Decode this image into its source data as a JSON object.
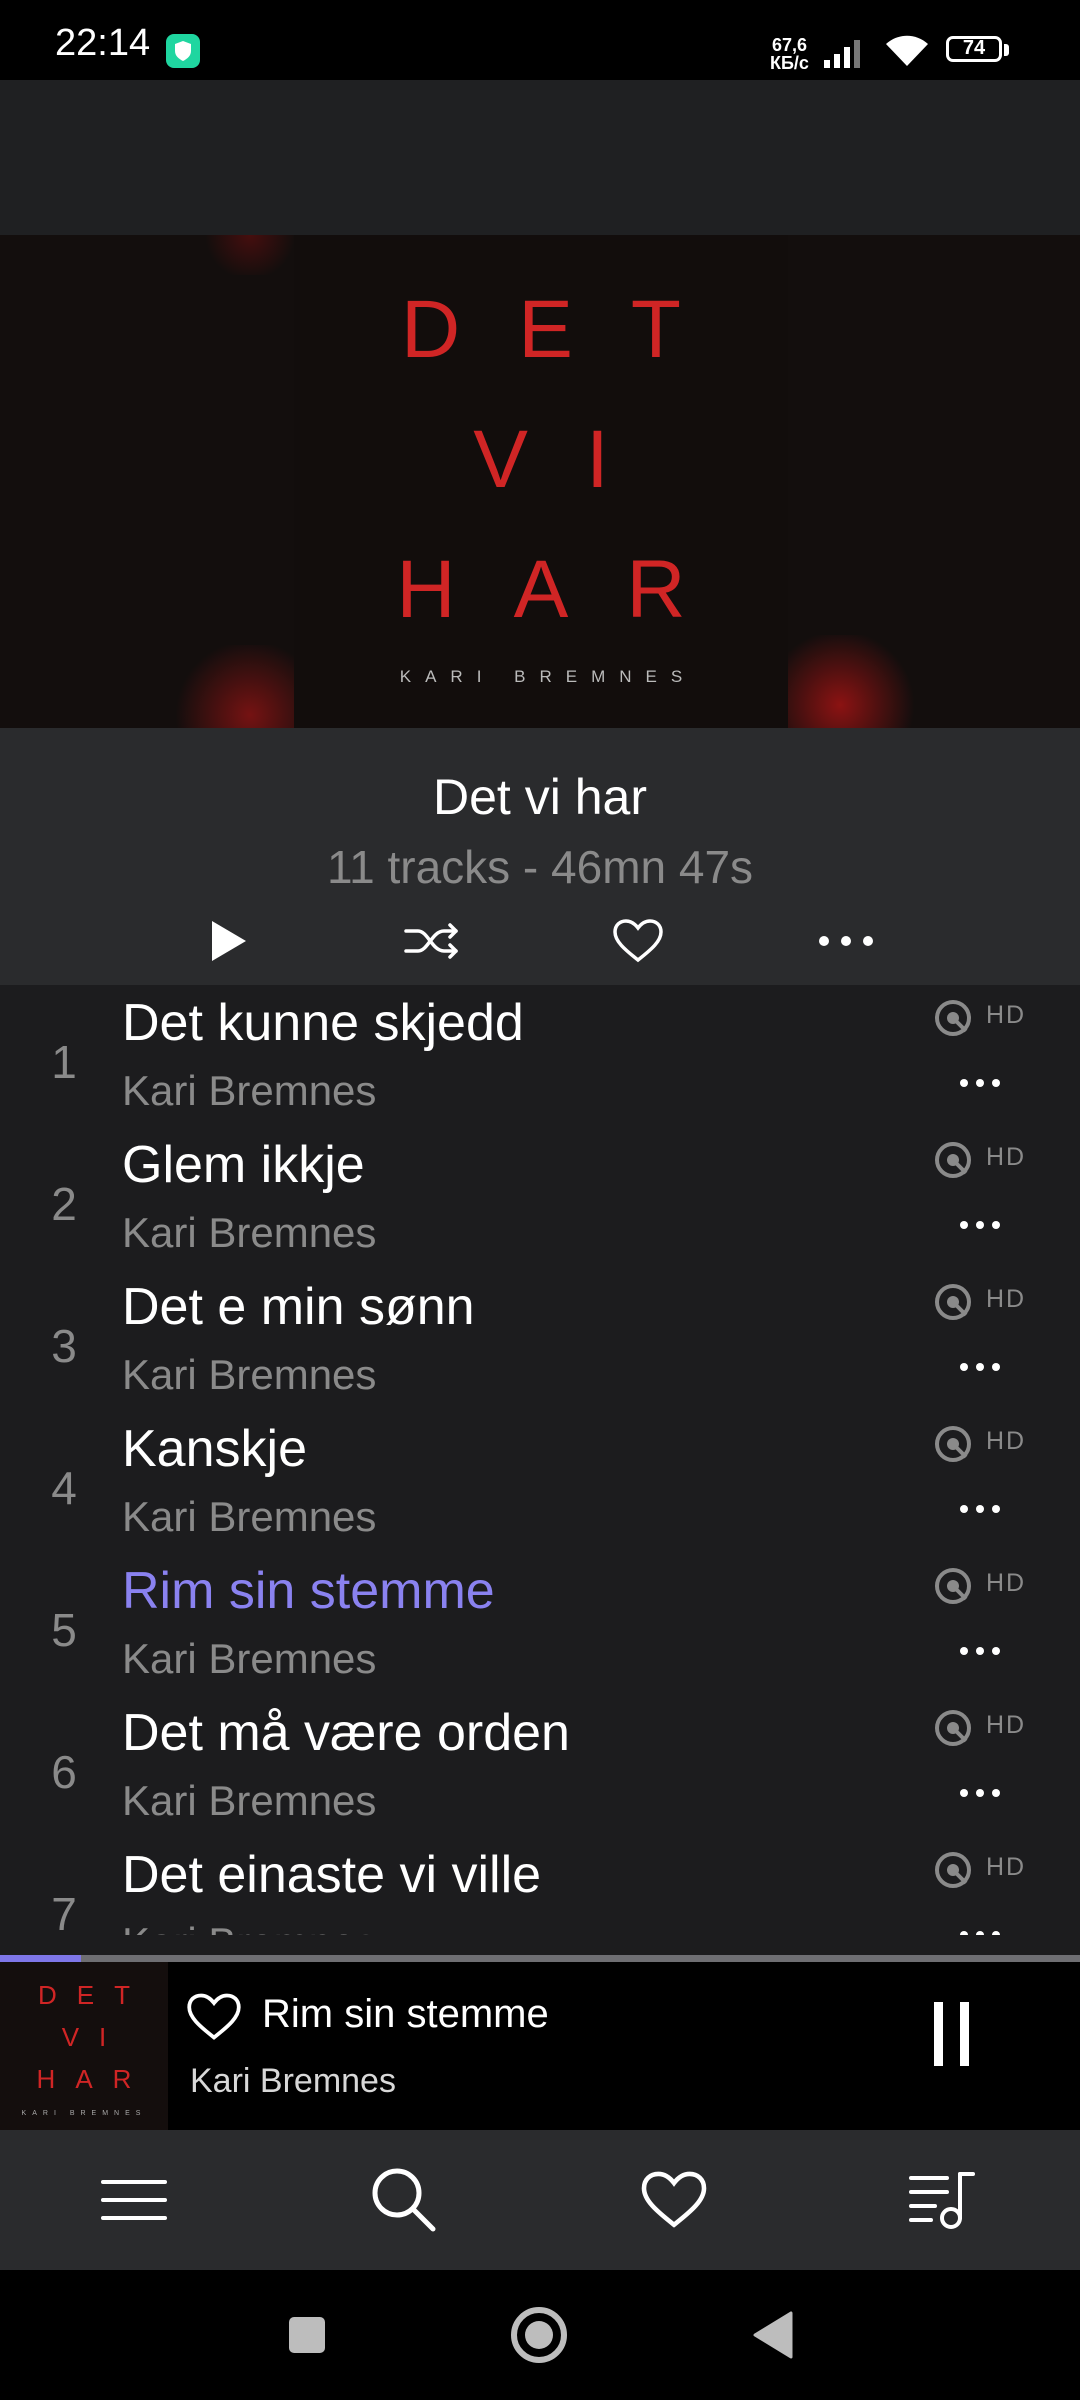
{
  "status_bar": {
    "time": "22:14",
    "net_speed_value": "67,6",
    "net_speed_unit": "КБ/с",
    "battery": "74"
  },
  "album_cover": {
    "line1": "DET",
    "line2": "VI",
    "line3": "HAR",
    "artist": "KARI BREMNES"
  },
  "album": {
    "title": "Det vi har",
    "meta": "11 tracks - 46mn 47s"
  },
  "tracks": [
    {
      "number": "1",
      "title": "Det kunne skjedd",
      "artist": "Kari Bremnes",
      "quality": "HD"
    },
    {
      "number": "2",
      "title": "Glem ikkje",
      "artist": "Kari Bremnes",
      "quality": "HD"
    },
    {
      "number": "3",
      "title": "Det e min sønn",
      "artist": "Kari Bremnes",
      "quality": "HD"
    },
    {
      "number": "4",
      "title": "Kanskje",
      "artist": "Kari Bremnes",
      "quality": "HD"
    },
    {
      "number": "5",
      "title": "Rim sin stemme",
      "artist": "Kari Bremnes",
      "quality": "HD"
    },
    {
      "number": "6",
      "title": "Det må være orden",
      "artist": "Kari Bremnes",
      "quality": "HD"
    },
    {
      "number": "7",
      "title": "Det einaste vi ville",
      "artist": "Kari Bremnes",
      "quality": "HD"
    }
  ],
  "now_playing": {
    "title": "Rim sin stemme",
    "artist": "Kari Bremnes",
    "progress_fraction": 0.075
  },
  "colors": {
    "accent": "#8a82f0",
    "cover_red": "#d02525",
    "background": "#1c1c1e"
  },
  "icons": {
    "actions": [
      "play-icon",
      "shuffle-icon",
      "heart-icon",
      "more-icon"
    ],
    "bottom_nav": [
      "menu-icon",
      "search-icon",
      "heart-icon",
      "queue-music-icon"
    ],
    "system_nav": [
      "recent-apps-icon",
      "home-icon",
      "back-icon"
    ]
  }
}
